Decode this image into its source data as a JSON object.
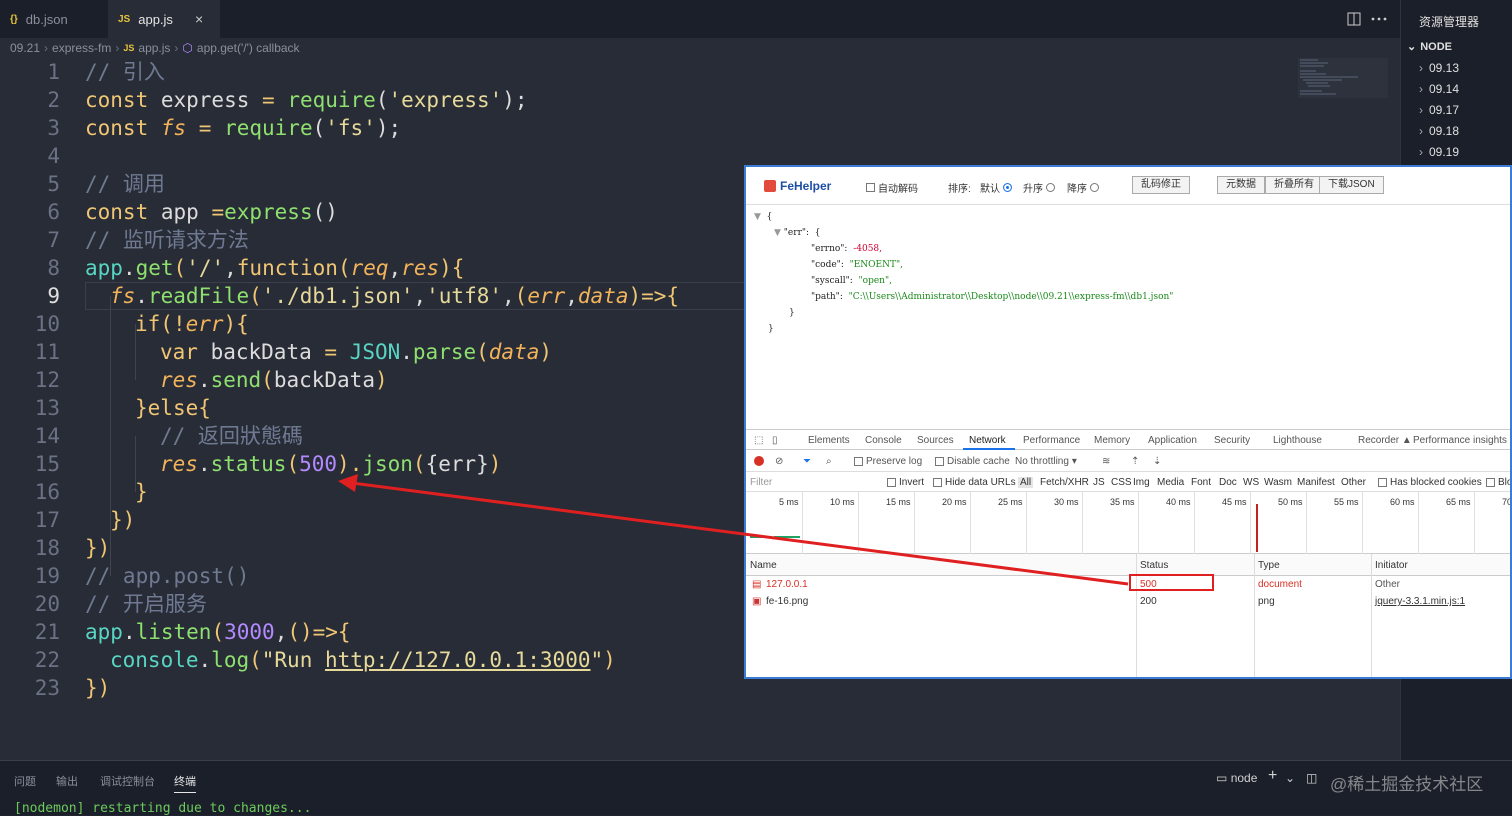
{
  "tabs": [
    {
      "icon": "{}",
      "label": "db.json"
    },
    {
      "icon": "JS",
      "label": "app.js"
    }
  ],
  "tab_close": "×",
  "breadcrumb": [
    "09.21",
    "express-fm",
    "app.js",
    "app.get('/') callback"
  ],
  "code_lines": [
    "1",
    "2",
    "3",
    "4",
    "5",
    "6",
    "7",
    "8",
    "9",
    "10",
    "11",
    "12",
    "13",
    "14",
    "15",
    "16",
    "17",
    "18",
    "19",
    "20",
    "21",
    "22",
    "23"
  ],
  "code": {
    "l1": "// 引入",
    "l2a": "const",
    "l2b": " express ",
    "l2c": "=",
    "l2d": " require",
    "l2e": "(",
    "l2f": "'express'",
    "l2g": ");",
    "l3a": "const",
    "l3b": " fs",
    "l3c": " = ",
    "l3d": "require",
    "l3e": "(",
    "l3f": "'fs'",
    "l3g": ");",
    "l5": "// 调用",
    "l6a": "const",
    "l6b": " app ",
    "l6c": "=",
    "l6d": "express",
    "l6e": "()",
    "l7": "// 监听请求方法",
    "l8a": "app",
    "l8b": ".",
    "l8c": "get",
    "l8d": "(",
    "l8e": "'/'",
    "l8f": ",",
    "l8g": "function",
    "l8h": "(",
    "l8i": "req",
    "l8j": ",",
    "l8k": "res",
    "l8l": "){",
    "l9a": "fs",
    "l9b": ".",
    "l9c": "readFile",
    "l9d": "(",
    "l9e": "'./db1.json'",
    "l9f": ",",
    "l9g": "'utf8'",
    "l9h": ",",
    "l9i": "(",
    "l9j": "err",
    "l9k": ",",
    "l9l": "data",
    "l9m": ")=>{",
    "l10a": "if",
    "l10b": "(!",
    "l10c": "err",
    "l10d": "){",
    "l11a": "var",
    "l11b": " backData ",
    "l11c": "=",
    "l11d": " JSON",
    "l11e": ".",
    "l11f": "parse",
    "l11g": "(",
    "l11h": "data",
    "l11i": ")",
    "l12a": "res",
    "l12b": ".",
    "l12c": "send",
    "l12d": "(",
    "l12e": "backData",
    "l12f": ")",
    "l13a": "}",
    "l13b": "else",
    "l13c": "{",
    "l14": "// 返回狀態碼",
    "l15a": "res",
    "l15b": ".",
    "l15c": "status",
    "l15d": "(",
    "l15e": "500",
    "l15f": ").",
    "l15g": "json",
    "l15h": "(",
    "l15i": "{err}",
    "l15j": ")",
    "l16": "}",
    "l17": "})",
    "l18": "})",
    "l19": "// app.post()",
    "l20": "// 开启服务",
    "l21a": "app",
    "l21b": ".",
    "l21c": "listen",
    "l21d": "(",
    "l21e": "3000",
    "l21f": ",",
    "l21g": "()=>{",
    "l22a": "console",
    "l22b": ".",
    "l22c": "log",
    "l22d": "(",
    "l22e": "\"Run ",
    "l22f": "http://127.0.0.1:3000",
    "l22g": "\"",
    "l22h": ")",
    "l23": "})"
  },
  "sidebar": {
    "title": "资源管理器",
    "section": "NODE",
    "items": [
      "09.13",
      "09.14",
      "09.17",
      "09.18",
      "09.19"
    ]
  },
  "panel": {
    "tabs": [
      "问题",
      "输出",
      "调试控制台",
      "终端"
    ],
    "terminal_line": "[nodemon] restarting due to changes...",
    "shell": "node",
    "add": "+",
    "watermark": "@稀土掘金技术社区"
  },
  "fehelper": {
    "logo": "FeHelper",
    "auto_decode": "自动解码",
    "sort_label": "排序:",
    "sort_default": "默认",
    "sort_asc": "升序",
    "sort_desc": "降序",
    "fix_btn": "乱码修正",
    "btn_meta": "元数据",
    "btn_fold": "折叠所有",
    "btn_download": "下载JSON"
  },
  "json_view": {
    "open": "{",
    "err_key": "\"err\":",
    "err_open": "{",
    "errno_key": "\"errno\":",
    "errno_val": "-4058,",
    "code_key": "\"code\":",
    "code_val": "\"ENOENT\",",
    "syscall_key": "\"syscall\":",
    "syscall_val": "\"open\",",
    "path_key": "\"path\":",
    "path_val": "\"C:\\\\Users\\\\Administrator\\\\Desktop\\\\node\\\\09.21\\\\express-fm\\\\db1.json\"",
    "err_close": "}",
    "close": "}"
  },
  "devtools": {
    "tabs": [
      "Elements",
      "Console",
      "Sources",
      "Network",
      "Performance",
      "Memory",
      "Application",
      "Security",
      "Lighthouse",
      "Recorder",
      "Performance insights"
    ],
    "recorder_icon": "▲",
    "preserve_log": "Preserve log",
    "disable_cache": "Disable cache",
    "throttling": "No throttling",
    "filter_placeholder": "Filter",
    "invert": "Invert",
    "hide_data_urls": "Hide data URLs",
    "types": [
      "All",
      "Fetch/XHR",
      "JS",
      "CSS",
      "Img",
      "Media",
      "Font",
      "Doc",
      "WS",
      "Wasm",
      "Manifest",
      "Other"
    ],
    "blocked_cookies": "Has blocked cookies",
    "blocked_req": "Blo",
    "ticks": [
      "5 ms",
      "10 ms",
      "15 ms",
      "20 ms",
      "25 ms",
      "30 ms",
      "35 ms",
      "40 ms",
      "45 ms",
      "50 ms",
      "55 ms",
      "60 ms",
      "65 ms",
      "70"
    ],
    "columns": [
      "Name",
      "Status",
      "Type",
      "Initiator"
    ],
    "rows": [
      {
        "name": "127.0.0.1",
        "status": "500",
        "type": "document",
        "initiator": "Other"
      },
      {
        "name": "fe-16.png",
        "status": "200",
        "type": "png",
        "initiator": "jquery-3.3.1.min.js:1"
      }
    ]
  },
  "colors": {
    "accent": "#1a73e8",
    "error": "#d93025",
    "arrow": "#e02020"
  }
}
